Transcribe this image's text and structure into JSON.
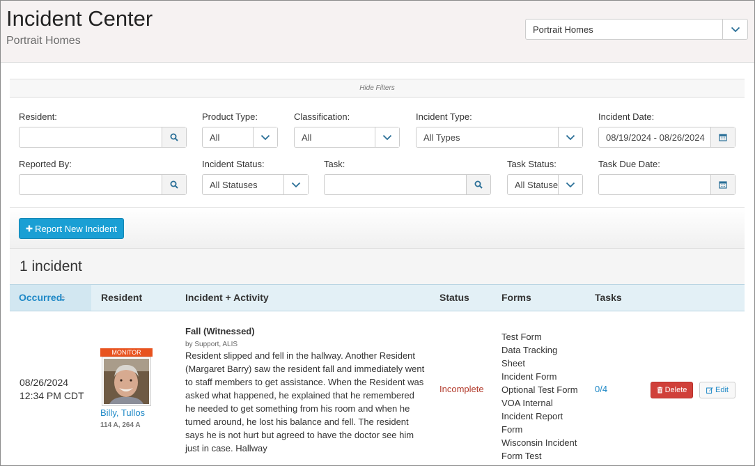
{
  "header": {
    "title": "Incident Center",
    "subtitle": "Portrait Homes",
    "community_select": "Portrait Homes"
  },
  "filters": {
    "toggle_label": "Hide Filters",
    "resident": {
      "label": "Resident:",
      "value": ""
    },
    "product_type": {
      "label": "Product Type:",
      "value": "All"
    },
    "classification": {
      "label": "Classification:",
      "value": "All"
    },
    "incident_type": {
      "label": "Incident Type:",
      "value": "All Types"
    },
    "incident_date": {
      "label": "Incident Date:",
      "value": "08/19/2024 - 08/26/2024"
    },
    "reported_by": {
      "label": "Reported By:",
      "value": ""
    },
    "incident_status": {
      "label": "Incident Status:",
      "value": "All Statuses"
    },
    "task": {
      "label": "Task:",
      "value": ""
    },
    "task_status": {
      "label": "Task Status:",
      "value": "All Statuses"
    },
    "task_due_date": {
      "label": "Task Due Date:",
      "value": ""
    }
  },
  "actions": {
    "report_new": "Report New Incident"
  },
  "results": {
    "count_label": "1 incident"
  },
  "table": {
    "columns": {
      "occurred": "Occurred",
      "resident": "Resident",
      "incident_activity": "Incident + Activity",
      "status": "Status",
      "forms": "Forms",
      "tasks": "Tasks"
    },
    "rows": [
      {
        "occurred_date": "08/26/2024",
        "occurred_time": "12:34 PM CDT",
        "monitor_tag": "MONITOR",
        "resident_name": "Billy, Tullos",
        "resident_room": "114 A, 264 A",
        "incident_title": "Fall (Witnessed)",
        "incident_by": "by Support, ALIS",
        "incident_description": "Resident slipped and fell in the hallway. Another Resident (Margaret Barry) saw the resident fall and immediately went to staff members to get assistance. When the Resident was asked what happened, he explained that he remembered he needed to get something from his room and when he turned around, he lost his balance and fell. The resident says he is not hurt but agreed to have the doctor see him just in case. Hallway",
        "status": "Incomplete",
        "forms": [
          "Test Form",
          "Data Tracking Sheet",
          "Incident Form",
          "Optional Test Form",
          "VOA Internal",
          "Incident Report Form",
          "Wisconsin Incident Form Test"
        ],
        "tasks": "0/4",
        "delete_label": "Delete",
        "edit_label": "Edit"
      }
    ]
  },
  "colors": {
    "link": "#1e88c6",
    "primary_button": "#1a9fd4",
    "danger_button": "#d0403a",
    "status_incomplete": "#b23a2b",
    "monitor_tag": "#e8531f"
  }
}
